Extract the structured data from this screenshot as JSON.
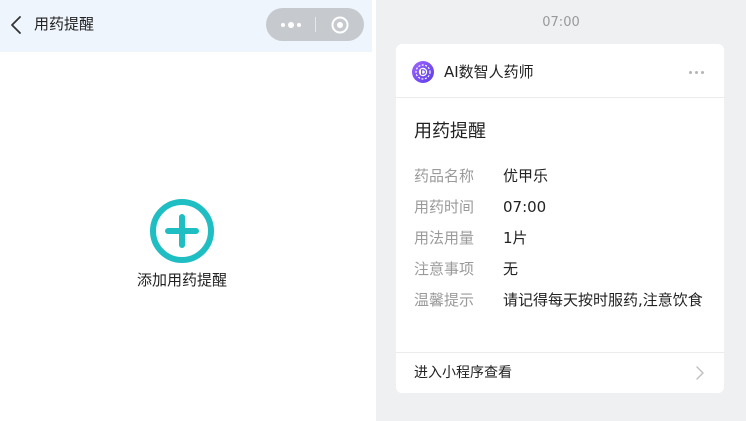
{
  "left": {
    "title": "用药提醒",
    "add_label": "添加用药提醒"
  },
  "right": {
    "time": "07:00",
    "sender": "AI数智人药师",
    "card_title": "用药提醒",
    "fields": [
      {
        "label": "药品名称",
        "value": "优甲乐"
      },
      {
        "label": "用药时间",
        "value": "07:00"
      },
      {
        "label": "用法用量",
        "value": "1片"
      },
      {
        "label": "注意事项",
        "value": "无"
      },
      {
        "label": "温馨提示",
        "value": "请记得每天按时服药,注意饮食"
      }
    ],
    "footer_label": "进入小程序查看"
  },
  "colors": {
    "nav_bg": "#eef5fd",
    "accent_teal": "#1fbec3",
    "capsule": "#c6cacf",
    "chat_bg": "#eff0f2",
    "avatar_purple": "#7b4cf0"
  },
  "icons": {
    "back": "chevron-left-icon",
    "menu": "more-dots-icon",
    "close": "target-circle-icon",
    "add": "plus-circle-icon",
    "avatar": "pharmacist-avatar-icon",
    "footer": "chevron-right-icon"
  }
}
